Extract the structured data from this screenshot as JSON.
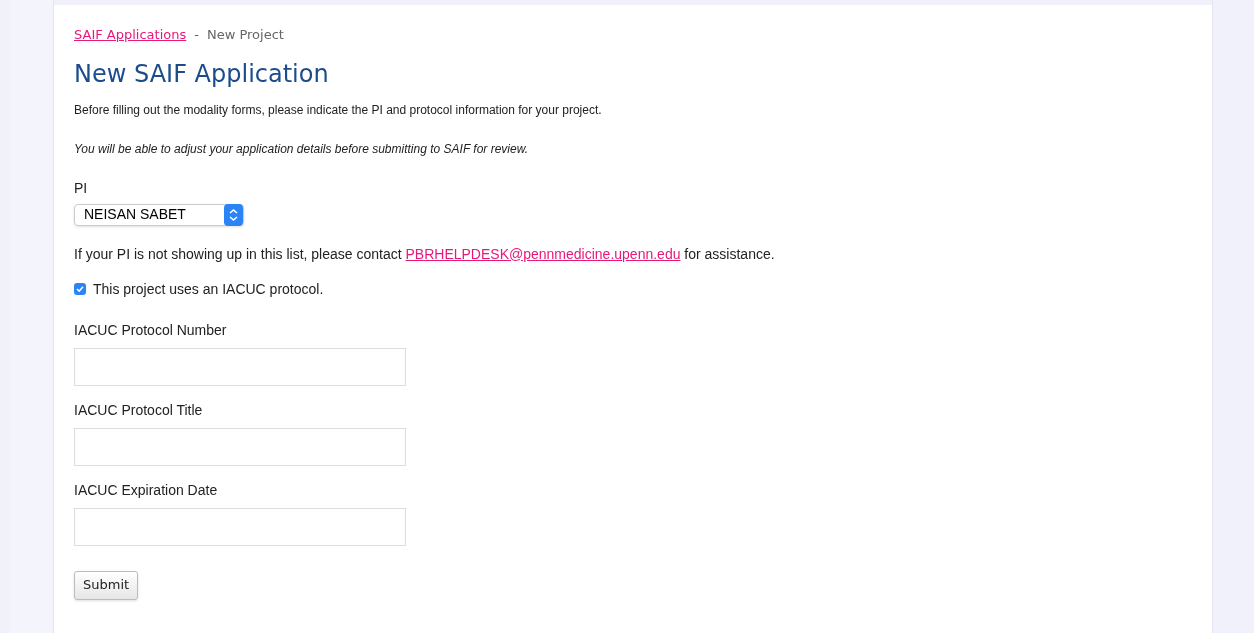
{
  "breadcrumb": {
    "link": "SAIF Applications",
    "separator": "-",
    "current": "New Project"
  },
  "title": "New SAIF Application",
  "intro": "Before filling out the modality forms, please indicate the PI and protocol information for your project.",
  "note": "You will be able to adjust your application details before submitting to SAIF for review.",
  "pi": {
    "label": "PI",
    "value": "NEISAN SABET"
  },
  "help": {
    "before": "If your PI is not showing up in this list, please contact",
    "link": "PBRHELPDESK@pennmedicine.upenn.edu",
    "after": "for assistance."
  },
  "iacuc_checkbox": {
    "label": "This project uses an IACUC protocol.",
    "checked": true
  },
  "fields": [
    {
      "label": "IACUC Protocol Number"
    },
    {
      "label": "IACUC Protocol Title"
    },
    {
      "label": "IACUC Expiration Date"
    }
  ],
  "submit": "Submit"
}
